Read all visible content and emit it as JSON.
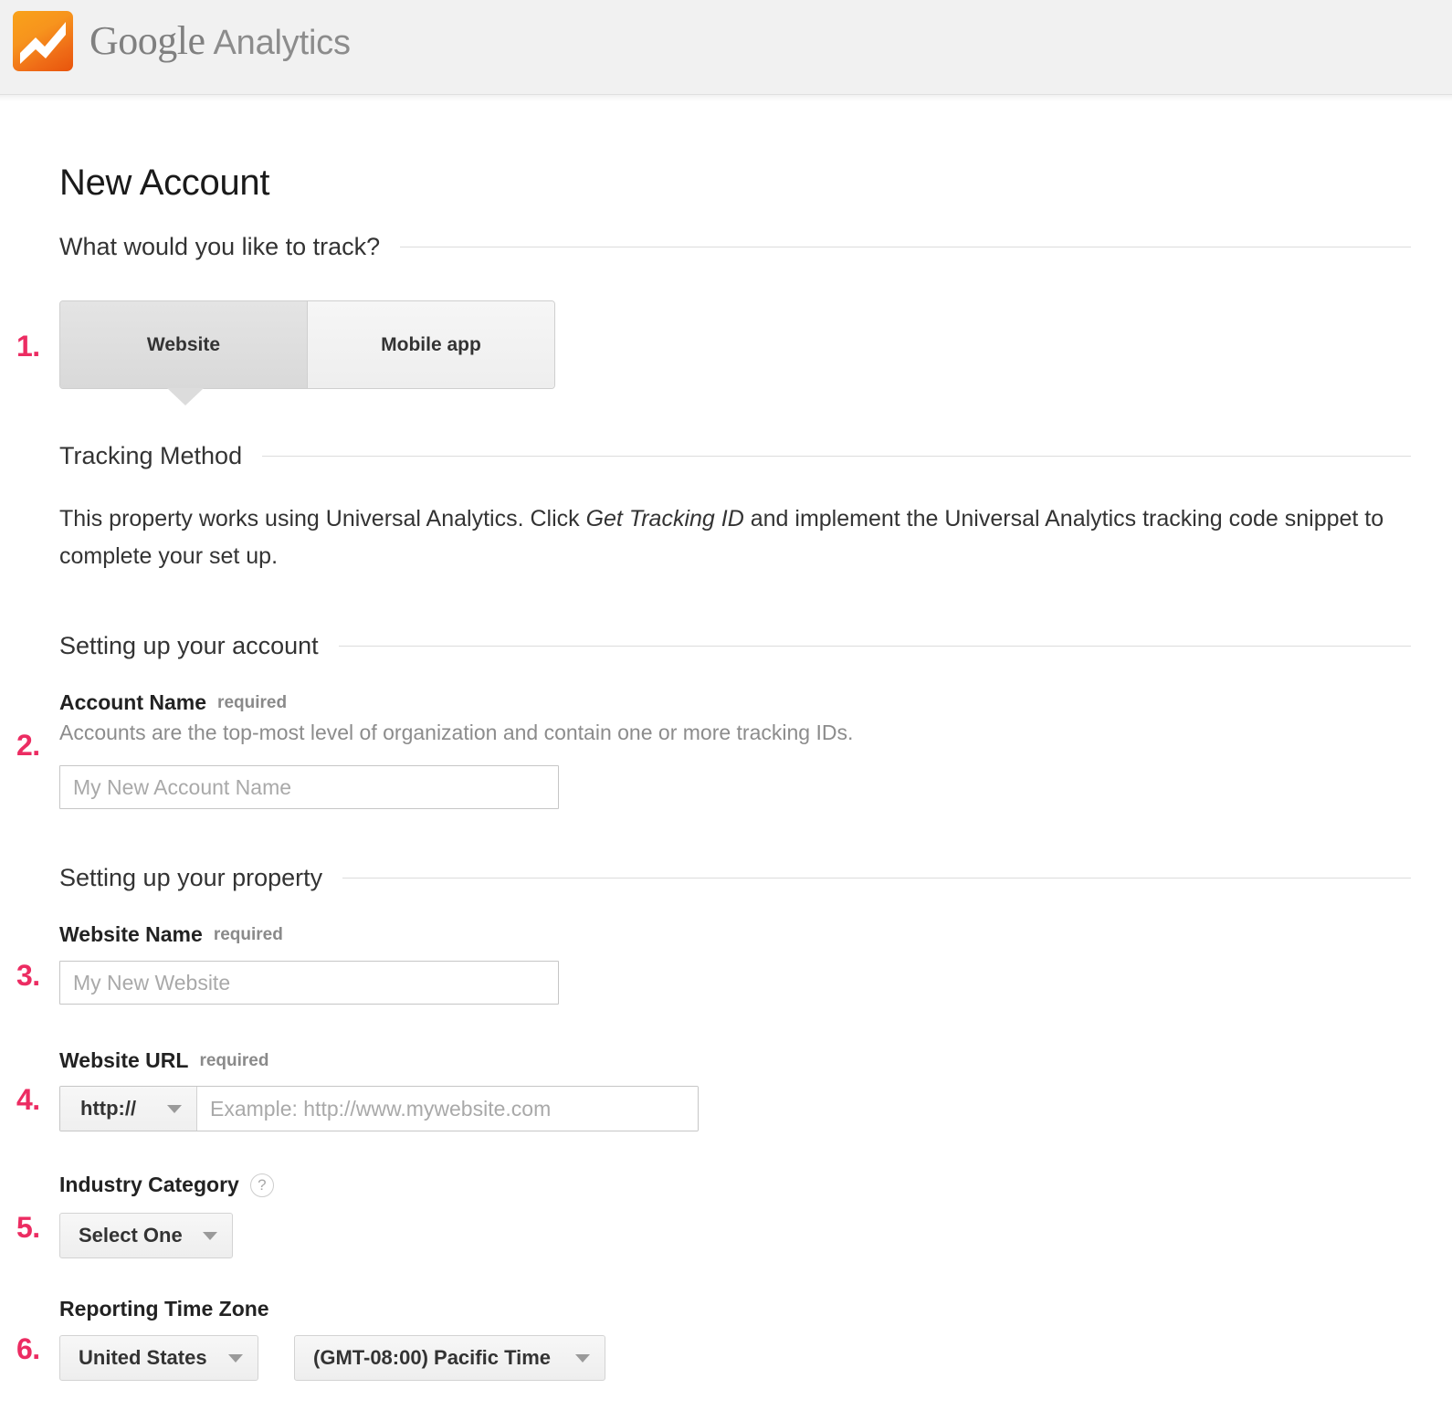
{
  "header": {
    "brand_google": "Google",
    "brand_analytics": "Analytics",
    "logo_icon": "google-analytics-logo-icon",
    "logo_colors": {
      "orange_light": "#f9a21a",
      "orange_dark": "#e8540c"
    }
  },
  "page": {
    "title": "New Account",
    "accent_step_color": "#ec2c62"
  },
  "track_section": {
    "heading": "What would you like to track?",
    "step": "1.",
    "options": [
      {
        "label": "Website",
        "selected": true
      },
      {
        "label": "Mobile app",
        "selected": false
      }
    ]
  },
  "tracking_method": {
    "heading": "Tracking Method",
    "text_before": "This property works using Universal Analytics. Click ",
    "emphasis": "Get Tracking ID",
    "text_after": " and implement the Universal Analytics tracking code snippet to complete your set up."
  },
  "account_section": {
    "heading": "Setting up your account",
    "step": "2.",
    "account_name": {
      "label": "Account Name",
      "required_text": "required",
      "description": "Accounts are the top-most level of organization and contain one or more tracking IDs.",
      "placeholder": "My New Account Name",
      "value": ""
    }
  },
  "property_section": {
    "heading": "Setting up your property",
    "website_name": {
      "step": "3.",
      "label": "Website Name",
      "required_text": "required",
      "placeholder": "My New Website",
      "value": ""
    },
    "website_url": {
      "step": "4.",
      "label": "Website URL",
      "required_text": "required",
      "scheme_value": "http://",
      "placeholder": "Example: http://www.mywebsite.com",
      "value": ""
    },
    "industry_category": {
      "step": "5.",
      "label": "Industry Category",
      "help_icon": "question-mark-icon",
      "selected_value": "Select One"
    },
    "reporting_time_zone": {
      "step": "6.",
      "label": "Reporting Time Zone",
      "country_value": "United States",
      "zone_value": "(GMT-08:00) Pacific Time"
    }
  }
}
